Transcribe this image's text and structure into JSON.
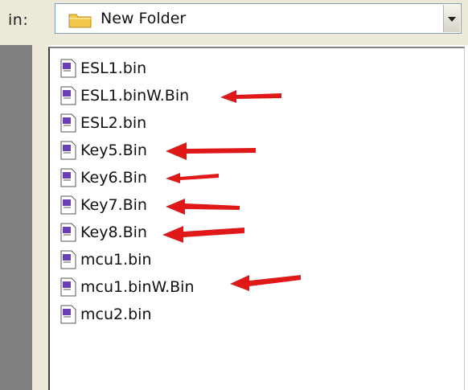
{
  "look_in": {
    "label": "in:",
    "current_folder": "New Folder"
  },
  "files": [
    {
      "name": "ESL1.bin",
      "arrow": false
    },
    {
      "name": "ESL1.binW.Bin",
      "arrow": true
    },
    {
      "name": "ESL2.bin",
      "arrow": false
    },
    {
      "name": "Key5.Bin",
      "arrow": true
    },
    {
      "name": "Key6.Bin",
      "arrow": true
    },
    {
      "name": "Key7.Bin",
      "arrow": true
    },
    {
      "name": "Key8.Bin",
      "arrow": true
    },
    {
      "name": "mcu1.bin",
      "arrow": false
    },
    {
      "name": "mcu1.binW.Bin",
      "arrow": true
    },
    {
      "name": "mcu2.bin",
      "arrow": false
    }
  ],
  "colors": {
    "arrow": "#e01818",
    "folder": "#f2c94c",
    "file_icon_accent": "#6a3fb5"
  }
}
